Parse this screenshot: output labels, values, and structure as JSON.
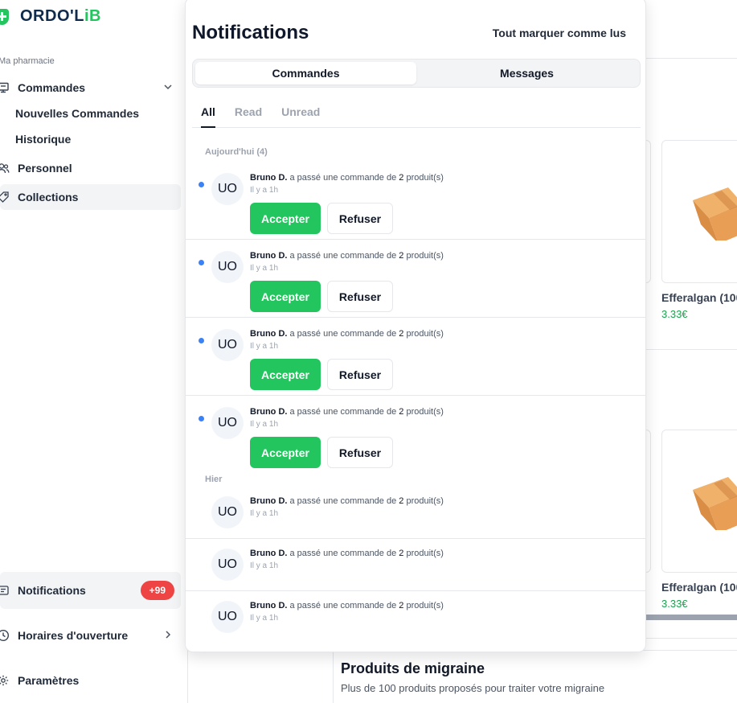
{
  "brand": {
    "logo_main": "ORDO'L",
    "logo_accent": "iB"
  },
  "sidebar": {
    "section_label": "Ma pharmacie",
    "items": [
      {
        "label": "Commandes",
        "icon": "monitor-icon"
      },
      {
        "label": "Nouvelles Commandes"
      },
      {
        "label": "Historique"
      },
      {
        "label": "Personnel",
        "icon": "users-icon"
      },
      {
        "label": "Collections",
        "icon": "tag-icon"
      }
    ],
    "bottom": {
      "notifications": {
        "label": "Notifications",
        "badge": "+99"
      },
      "hours": {
        "label": "Horaires d'ouverture"
      },
      "settings": {
        "label": "Paramètres"
      }
    }
  },
  "panel": {
    "title": "Notifications",
    "mark_all": "Tout marquer comme lus",
    "tabs": [
      "Commandes",
      "Messages"
    ],
    "active_tab": "Commandes",
    "filters": [
      "All",
      "Read",
      "Unread"
    ],
    "active_filter": "All",
    "groups": {
      "today": "Aujourd'hui (4)",
      "yesterday": "Hier"
    },
    "notification": {
      "initials": "UO",
      "name": "Bruno D.",
      "text_before": " a passé une commande de ",
      "count": "2",
      "text_after": " produit(s)",
      "time": "Il y a 1h",
      "accept": "Accepter",
      "refuse": "Refuser"
    }
  },
  "background": {
    "products": [
      {
        "name": "Efferalgan (100",
        "price": "3.33€"
      },
      {
        "name": "Efferalgan (100",
        "price": "3.33€"
      }
    ],
    "promo": {
      "title": "Produits de migraine",
      "subtitle": "Plus de 100 produits proposés pour traiter votre migraine"
    }
  },
  "colors": {
    "accent_green": "#22c55e",
    "unread_dot": "#3b82f6",
    "badge_red": "#ef4444"
  }
}
